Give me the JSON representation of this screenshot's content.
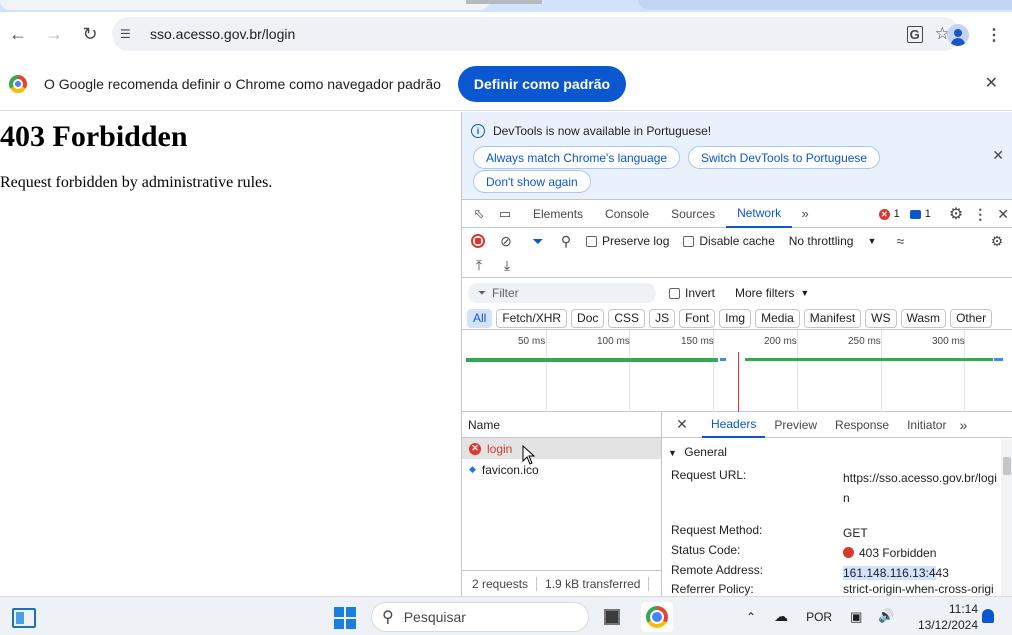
{
  "browser": {
    "url": "sso.acesso.gov.br/login",
    "infobar": {
      "message": "O Google recomenda definir o Chrome como navegador padrão",
      "button": "Definir como padrão"
    }
  },
  "page": {
    "heading": "403 Forbidden",
    "body": "Request forbidden by administrative rules."
  },
  "devtools": {
    "banner": {
      "text": "DevTools is now available in Portuguese!",
      "btn_match": "Always match Chrome's language",
      "btn_switch": "Switch DevTools to Portuguese",
      "btn_dont": "Don't show again"
    },
    "tabs": [
      "Elements",
      "Console",
      "Sources",
      "Network"
    ],
    "error_count": "1",
    "message_count": "1",
    "toolbar": {
      "preserve_log": "Preserve log",
      "disable_cache": "Disable cache",
      "throttling": "No throttling"
    },
    "filter": {
      "placeholder": "Filter",
      "invert": "Invert",
      "more_filters": "More filters"
    },
    "type_filters": [
      "All",
      "Fetch/XHR",
      "Doc",
      "CSS",
      "JS",
      "Font",
      "Img",
      "Media",
      "Manifest",
      "WS",
      "Wasm",
      "Other"
    ],
    "timeline_ticks": [
      "50 ms",
      "100 ms",
      "150 ms",
      "200 ms",
      "250 ms",
      "300 ms"
    ],
    "request_list": {
      "header": "Name",
      "items": [
        "login",
        "favicon.ico"
      ],
      "footer_requests": "2 requests",
      "footer_transferred": "1.9 kB transferred"
    },
    "details": {
      "tabs": [
        "Headers",
        "Preview",
        "Response",
        "Initiator"
      ],
      "section": "General",
      "request_url_label": "Request URL:",
      "request_url_value": "https://sso.acesso.gov.br/login",
      "method_label": "Request Method:",
      "method_value": "GET",
      "status_label": "Status Code:",
      "status_value": "403 Forbidden",
      "remote_label": "Remote Address:",
      "remote_value_hl": "161.148.116.13:4",
      "remote_value_rest": "43",
      "referrer_label": "Referrer Policy:",
      "referrer_value": "strict-origin-when-cross-origi"
    }
  },
  "taskbar": {
    "search_placeholder": "Pesquisar",
    "language": "POR",
    "time": "11:14",
    "date": "13/12/2024"
  }
}
